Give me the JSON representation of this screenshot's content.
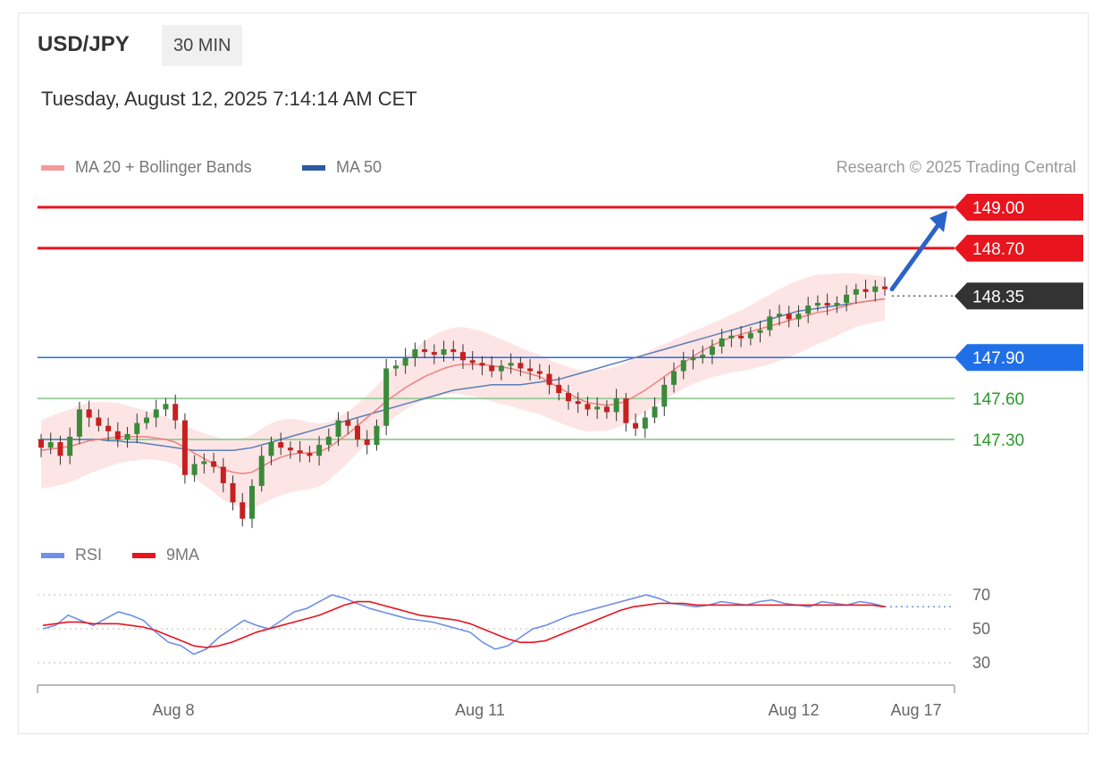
{
  "header": {
    "symbol": "USD/JPY",
    "timeframe": "30 MIN",
    "datetime": "Tuesday, August 12, 2025 7:14:14 AM CET",
    "credit": "Research © 2025 Trading Central"
  },
  "legend": {
    "ma20_label": "MA 20 + Bollinger Bands",
    "ma50_label": "MA 50",
    "rsi_label": "RSI",
    "rsi_ma_label": "9MA"
  },
  "colors": {
    "resistance": "#e8141e",
    "current": "#333333",
    "pivot": "#1f6fe8",
    "support": "#2a9a2a",
    "bull": "#3a8a3a",
    "bear": "#c62020",
    "ma20": "#f08080",
    "ma50": "#5a7fb5",
    "band": "#fde0e0",
    "rsi": "#6f8fe8",
    "rsi_ma": "#e8141e",
    "arrow": "#2b63c8"
  },
  "chart_data": [
    {
      "type": "candlestick",
      "ylim": [
        146.55,
        149.4
      ],
      "levels": [
        {
          "label": "149.00",
          "value": 149.0,
          "kind": "resistance"
        },
        {
          "label": "148.70",
          "value": 148.7,
          "kind": "resistance"
        },
        {
          "label": "148.35",
          "value": 148.35,
          "kind": "current"
        },
        {
          "label": "147.90",
          "value": 147.9,
          "kind": "pivot"
        },
        {
          "label": "147.60",
          "value": 147.6,
          "kind": "support"
        },
        {
          "label": "147.30",
          "value": 147.3,
          "kind": "support"
        }
      ],
      "x_ticks": [
        "Aug 8",
        "Aug 11",
        "Aug 12",
        "Aug 17"
      ],
      "close": [
        147.24,
        147.28,
        147.18,
        147.32,
        147.52,
        147.46,
        147.4,
        147.36,
        147.3,
        147.34,
        147.42,
        147.46,
        147.52,
        147.56,
        147.44,
        147.04,
        147.12,
        147.14,
        147.1,
        146.98,
        146.84,
        146.72,
        146.96,
        147.18,
        147.28,
        147.24,
        147.22,
        147.2,
        147.18,
        147.26,
        147.32,
        147.44,
        147.4,
        147.3,
        147.26,
        147.4,
        147.82,
        147.84,
        147.9,
        147.96,
        147.94,
        147.92,
        147.96,
        147.94,
        147.88,
        147.86,
        147.84,
        147.8,
        147.84,
        147.86,
        147.82,
        147.8,
        147.78,
        147.7,
        147.64,
        147.58,
        147.56,
        147.52,
        147.54,
        147.5,
        147.6,
        147.42,
        147.38,
        147.46,
        147.54,
        147.7,
        147.8,
        147.88,
        147.9,
        147.92,
        147.98,
        148.04,
        148.06,
        148.04,
        148.08,
        148.1,
        148.2,
        148.22,
        148.18,
        148.22,
        148.28,
        148.3,
        148.28,
        148.3,
        148.36,
        148.4,
        148.38,
        148.42,
        148.4
      ],
      "open": [
        147.3,
        147.24,
        147.28,
        147.18,
        147.32,
        147.52,
        147.46,
        147.4,
        147.36,
        147.3,
        147.34,
        147.42,
        147.46,
        147.52,
        147.56,
        147.44,
        147.04,
        147.12,
        147.14,
        147.1,
        146.98,
        146.84,
        146.72,
        146.96,
        147.18,
        147.28,
        147.24,
        147.22,
        147.2,
        147.18,
        147.26,
        147.32,
        147.44,
        147.4,
        147.3,
        147.26,
        147.4,
        147.82,
        147.84,
        147.9,
        147.96,
        147.94,
        147.92,
        147.96,
        147.94,
        147.88,
        147.86,
        147.84,
        147.8,
        147.84,
        147.86,
        147.82,
        147.8,
        147.78,
        147.7,
        147.64,
        147.58,
        147.56,
        147.52,
        147.54,
        147.5,
        147.6,
        147.42,
        147.38,
        147.46,
        147.54,
        147.7,
        147.8,
        147.88,
        147.9,
        147.92,
        147.98,
        148.04,
        148.06,
        148.04,
        148.08,
        148.1,
        148.2,
        148.22,
        148.18,
        148.22,
        148.28,
        148.3,
        148.28,
        148.3,
        148.36,
        148.4,
        148.38,
        148.42
      ],
      "ma20": [
        147.22,
        147.23,
        147.24,
        147.25,
        147.27,
        147.29,
        147.3,
        147.31,
        147.32,
        147.32,
        147.32,
        147.32,
        147.31,
        147.3,
        147.28,
        147.24,
        147.2,
        147.16,
        147.12,
        147.08,
        147.06,
        147.05,
        147.06,
        147.1,
        147.14,
        147.17,
        147.19,
        147.2,
        147.2,
        147.21,
        147.24,
        147.29,
        147.34,
        147.4,
        147.46,
        147.52,
        147.58,
        147.63,
        147.68,
        147.72,
        147.76,
        147.79,
        147.82,
        147.84,
        147.85,
        147.85,
        147.85,
        147.84,
        147.83,
        147.82,
        147.8,
        147.78,
        147.76,
        147.72,
        147.68,
        147.64,
        147.6,
        147.57,
        147.56,
        147.55,
        147.56,
        147.58,
        147.62,
        147.66,
        147.71,
        147.76,
        147.81,
        147.86,
        147.91,
        147.95,
        147.99,
        148.02,
        148.05,
        148.07,
        148.09,
        148.11,
        148.13,
        148.15,
        148.17,
        148.19,
        148.21,
        148.23,
        148.24,
        148.26,
        148.28,
        148.3,
        148.31,
        148.32,
        148.33
      ],
      "ma50": [
        147.3,
        147.3,
        147.3,
        147.3,
        147.3,
        147.3,
        147.3,
        147.29,
        147.29,
        147.28,
        147.28,
        147.27,
        147.26,
        147.25,
        147.24,
        147.23,
        147.22,
        147.22,
        147.22,
        147.22,
        147.22,
        147.23,
        147.24,
        147.26,
        147.28,
        147.3,
        147.32,
        147.34,
        147.36,
        147.38,
        147.4,
        147.42,
        147.44,
        147.46,
        147.48,
        147.5,
        147.52,
        147.54,
        147.56,
        147.58,
        147.6,
        147.62,
        147.64,
        147.66,
        147.67,
        147.68,
        147.69,
        147.7,
        147.7,
        147.7,
        147.7,
        147.71,
        147.72,
        147.73,
        147.74,
        147.76,
        147.78,
        147.8,
        147.82,
        147.84,
        147.86,
        147.88,
        147.9,
        147.92,
        147.94,
        147.96,
        147.98,
        148.0,
        148.02,
        148.04,
        148.06,
        148.08,
        148.1,
        148.12,
        148.14,
        148.16,
        148.18,
        148.2,
        148.22,
        148.24,
        148.25,
        148.26,
        148.27,
        148.28,
        148.29,
        148.3,
        148.31,
        148.32,
        148.33
      ]
    },
    {
      "type": "line",
      "ylim": [
        20,
        80
      ],
      "y_ticks": [
        {
          "label": "70",
          "value": 70
        },
        {
          "label": "50",
          "value": 50
        },
        {
          "label": "30",
          "value": 30
        }
      ],
      "series": [
        {
          "name": "RSI",
          "values": [
            50,
            52,
            58,
            55,
            52,
            56,
            60,
            58,
            55,
            48,
            42,
            40,
            35,
            38,
            45,
            50,
            55,
            52,
            50,
            55,
            60,
            62,
            66,
            70,
            68,
            65,
            62,
            60,
            58,
            56,
            55,
            54,
            52,
            50,
            48,
            42,
            38,
            40,
            45,
            50,
            52,
            55,
            58,
            60,
            62,
            64,
            66,
            68,
            70,
            68,
            65,
            64,
            63,
            64,
            66,
            65,
            64,
            66,
            67,
            65,
            64,
            63,
            66,
            65,
            64,
            66,
            65,
            63
          ]
        },
        {
          "name": "9MA",
          "values": [
            52,
            53,
            54,
            54,
            53,
            53,
            53,
            52,
            51,
            49,
            46,
            43,
            40,
            39,
            40,
            42,
            45,
            48,
            50,
            52,
            54,
            56,
            58,
            61,
            64,
            66,
            66,
            64,
            62,
            60,
            58,
            57,
            56,
            55,
            53,
            50,
            47,
            44,
            42,
            42,
            43,
            46,
            49,
            52,
            55,
            58,
            61,
            63,
            64,
            65,
            65,
            65,
            64,
            64,
            64,
            64,
            64,
            64,
            64,
            64,
            64,
            64,
            64,
            64,
            64,
            64,
            64,
            63
          ]
        }
      ]
    }
  ]
}
